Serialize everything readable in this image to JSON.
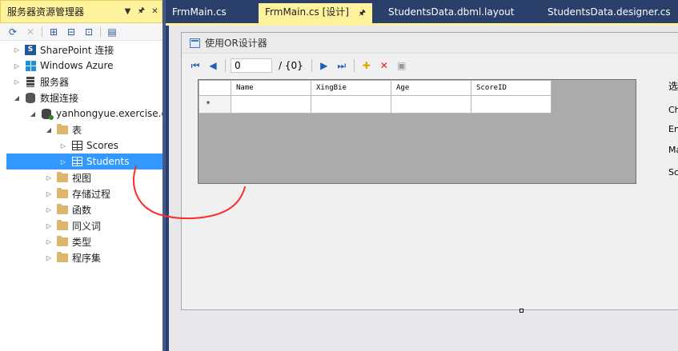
{
  "explorer": {
    "title": "服务器资源管理器",
    "controls": [
      "▼",
      "🖈",
      "✕"
    ],
    "tree": [
      {
        "label": "SharePoint 连接",
        "icon": "sharepoint-icon"
      },
      {
        "label": "Windows Azure",
        "icon": "windows-azure-icon"
      },
      {
        "label": "服务器",
        "icon": "server-icon"
      },
      {
        "label": "数据连接",
        "icon": "data-connection-icon"
      },
      {
        "label": "yanhongyue.exercise.c",
        "icon": "database-icon"
      },
      {
        "label": "表",
        "icon": "folder-icon"
      },
      {
        "label": "Scores",
        "icon": "table-icon"
      },
      {
        "label": "Students",
        "icon": "table-icon"
      },
      {
        "label": "视图",
        "icon": "folder-icon"
      },
      {
        "label": "存储过程",
        "icon": "folder-icon"
      },
      {
        "label": "函数",
        "icon": "folder-icon"
      },
      {
        "label": "同义词",
        "icon": "folder-icon"
      },
      {
        "label": "类型",
        "icon": "folder-icon"
      },
      {
        "label": "程序集",
        "icon": "folder-icon"
      }
    ]
  },
  "tabs": [
    {
      "label": "FrmMain.cs",
      "pin": ""
    },
    {
      "label": "FrmMain.cs [设计]",
      "pin": "🖈"
    },
    {
      "label": "StudentsData.dbml.layout",
      "pin": ""
    },
    {
      "label": "StudentsData.designer.cs",
      "pin": ""
    }
  ],
  "form": {
    "title": "使用OR设计器",
    "navigator": {
      "position": "0",
      "count": "/ {0}"
    },
    "grid": {
      "columns": [
        "Name",
        "XingBie",
        "Age",
        "ScoreID"
      ],
      "new_row_marker": "*"
    },
    "right_labels": [
      "选",
      "Ch",
      "En",
      "Ma",
      "Sc"
    ]
  },
  "colors": {
    "accent_tab": "#fff29d",
    "vs_blue": "#2b3f6b",
    "selection": "#3399ff",
    "annotation": "#ff2a2a"
  }
}
